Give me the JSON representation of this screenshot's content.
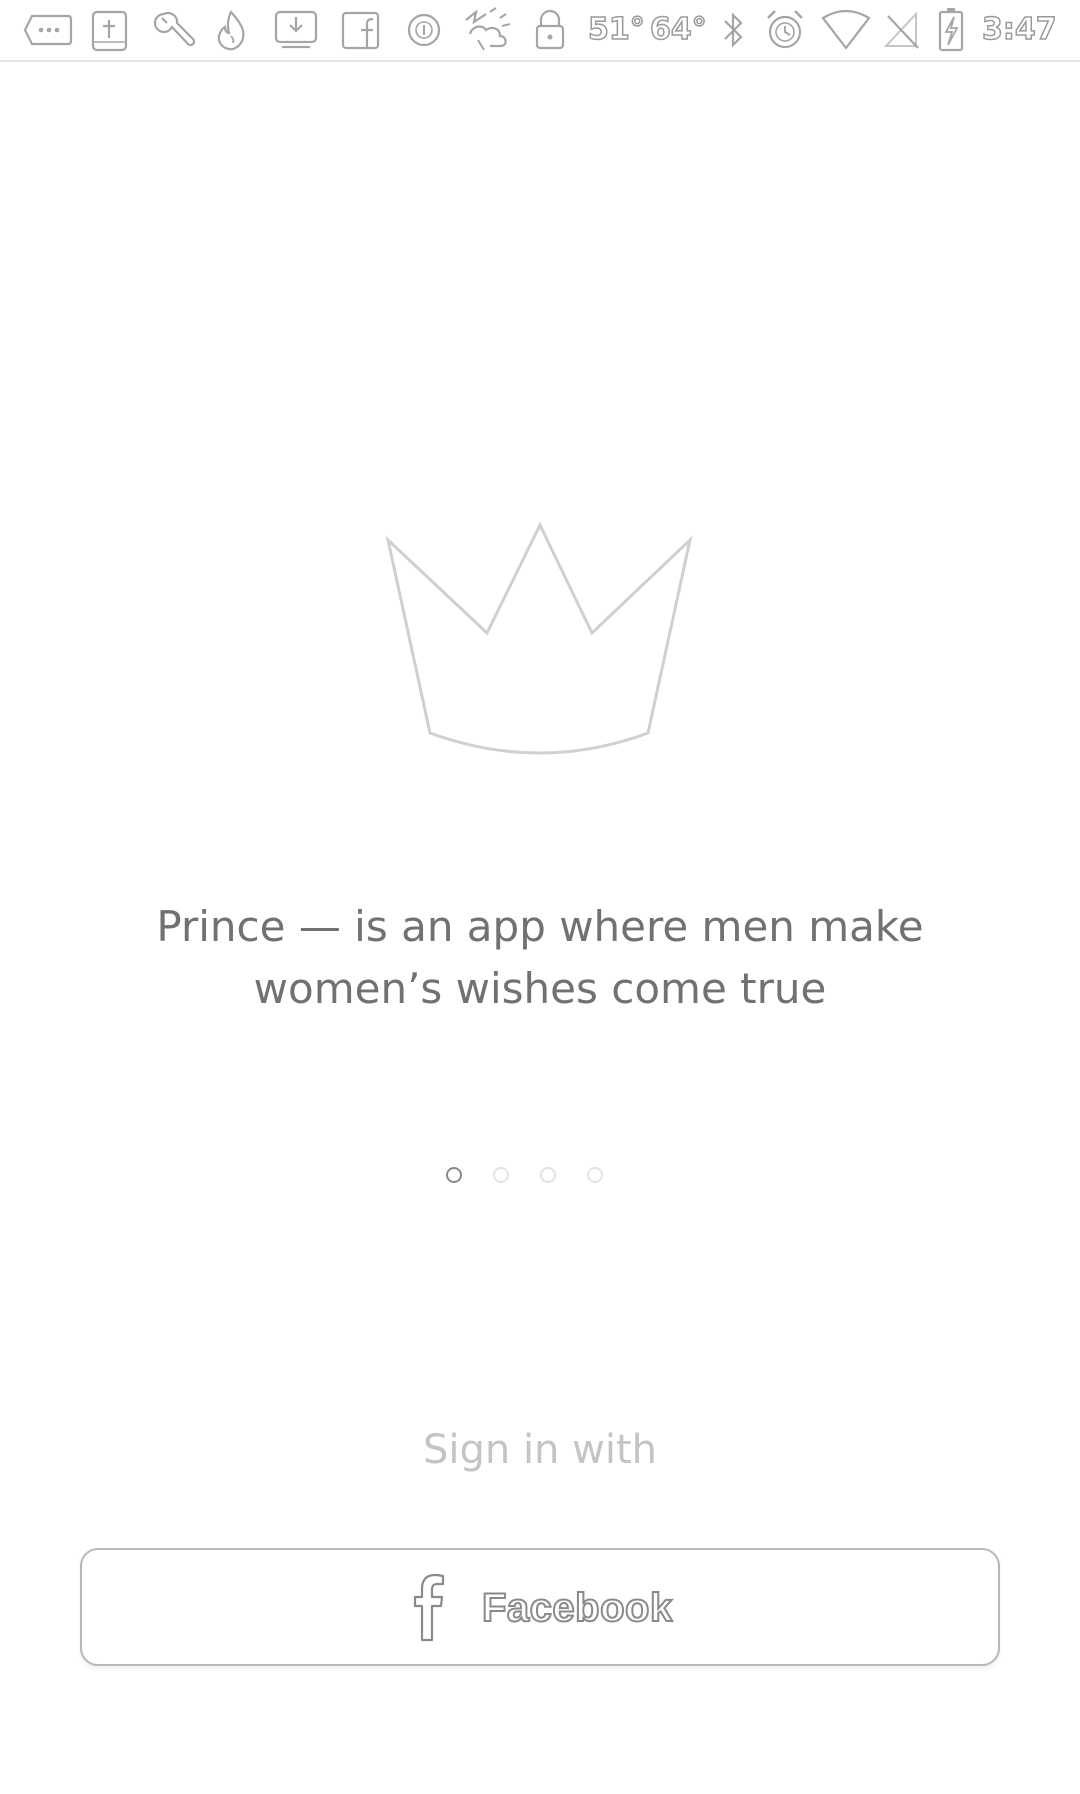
{
  "status_bar": {
    "icons": [
      "more-notifications-icon",
      "bible-app-icon",
      "wrench-icon",
      "tinder-flame-icon",
      "inbox-download-icon",
      "facebook-icon",
      "circle-info-icon",
      "weather-icon",
      "lock-icon",
      "bluetooth-icon",
      "alarm-icon",
      "wifi-icon",
      "no-signal-icon",
      "battery-charging-icon"
    ],
    "temp_current": "51°",
    "temp_high": "64°",
    "time": "3:47"
  },
  "intro": {
    "icon": "crown-icon",
    "headline_line1": "Prince — is an app where men make",
    "headline_line2": "women’s wishes come true",
    "page_count": 4,
    "active_page": 1
  },
  "sign_in": {
    "label": "Sign in with",
    "facebook_button_label": "Facebook",
    "facebook_icon": "facebook-f-icon"
  },
  "colors": {
    "background": "#ffffff",
    "text_primary": "#717171",
    "text_muted": "#c4c4c4",
    "border": "#b8b8b8"
  }
}
